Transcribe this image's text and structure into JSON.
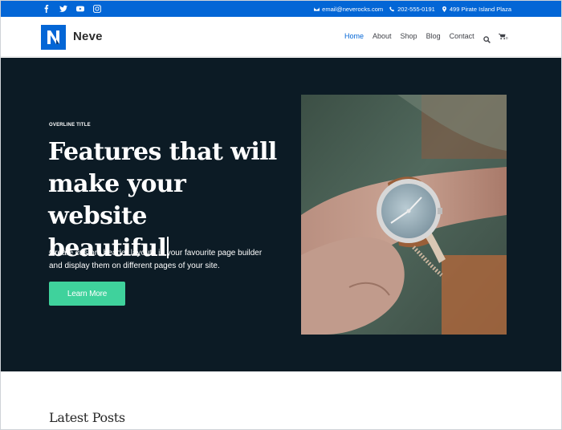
{
  "topbar": {
    "social": [
      {
        "icon": "facebook-icon"
      },
      {
        "icon": "twitter-icon"
      },
      {
        "icon": "youtube-icon"
      },
      {
        "icon": "instagram-icon"
      }
    ],
    "email": "email@neverocks.com",
    "phone": "202-555-0191",
    "address": "499 Pirate Island Plaza",
    "color": "#0366d6"
  },
  "header": {
    "logo_letter": "N",
    "brand": "Neve",
    "nav": [
      "Home",
      "About",
      "Shop",
      "Blog",
      "Contact"
    ],
    "active": "Home",
    "cart_count": "0"
  },
  "hero": {
    "overline": "OVERLINE TITLE",
    "headline_lines": [
      "Features that will",
      "make your website",
      "beautiful"
    ],
    "description_lines": [
      "Create custom header layouts in your favourite page builder",
      "and display them on different pages of your site."
    ],
    "button_label": "Learn More",
    "background": "#0c1b25",
    "button_color": "#3fd29c"
  },
  "latest": {
    "title": "Latest Posts"
  }
}
